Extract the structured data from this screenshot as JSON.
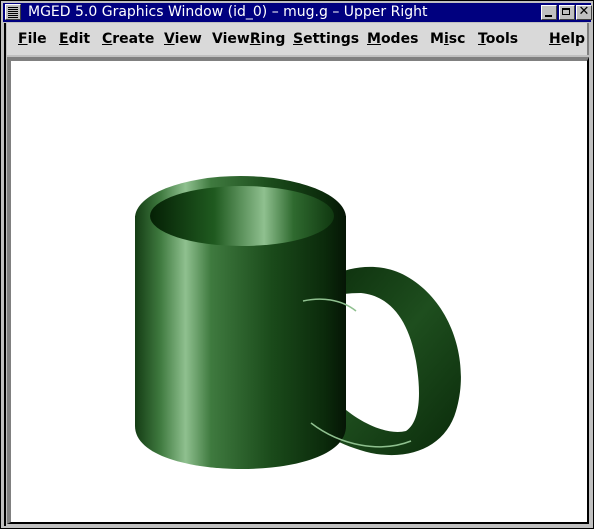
{
  "window": {
    "title": "MGED 5.0 Graphics Window (id_0) – mug.g – Upper Right",
    "controls": {
      "minimize": "minimize-icon",
      "maximize": "maximize-icon",
      "close": "✕"
    }
  },
  "menubar": {
    "items": [
      {
        "label": "File",
        "mnemonic_index": 0
      },
      {
        "label": "Edit",
        "mnemonic_index": 0
      },
      {
        "label": "Create",
        "mnemonic_index": 0
      },
      {
        "label": "View",
        "mnemonic_index": 0
      },
      {
        "label": "ViewRing",
        "mnemonic_index": 4
      },
      {
        "label": "Settings",
        "mnemonic_index": 0
      },
      {
        "label": "Modes",
        "mnemonic_index": 0
      },
      {
        "label": "Misc",
        "mnemonic_index": 1
      },
      {
        "label": "Tools",
        "mnemonic_index": 0
      },
      {
        "label": "Help",
        "mnemonic_index": 0
      }
    ]
  },
  "scene": {
    "object": "mug",
    "color": "#1f4f1f",
    "highlight": "#8fc08f",
    "background": "#ffffff"
  }
}
